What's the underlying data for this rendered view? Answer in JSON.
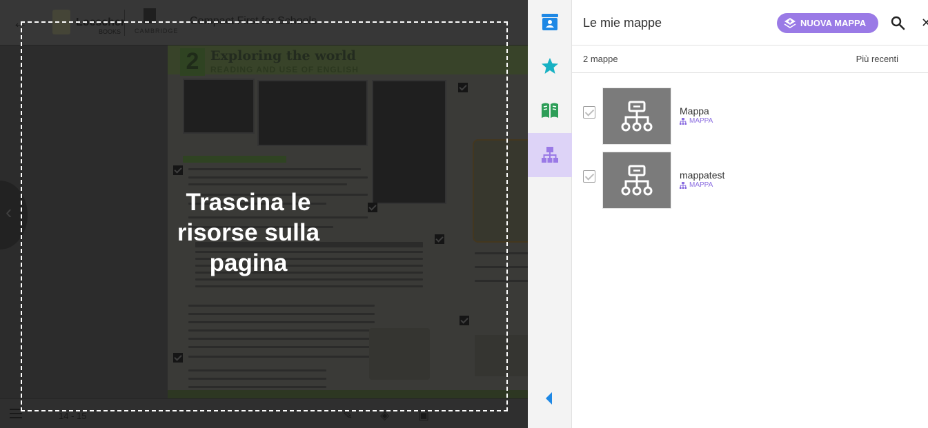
{
  "reader": {
    "brand_name": "Loescher",
    "brand_sub": "BOOKS",
    "brand_2": "CAMBRIDGE",
    "book_title": "Compact First for Schools",
    "unit_number": "2",
    "page_heading": "Exploring the world",
    "page_subheading": "READING AND USE OF ENGLISH",
    "page_range": "14 - 15",
    "drop_text": "Trascina le risorse sulla pagina"
  },
  "rail": {
    "items": [
      {
        "icon": "bag-person-icon",
        "color": "#1e88e5"
      },
      {
        "icon": "star-icon",
        "color": "#17b1c3"
      },
      {
        "icon": "book-icon",
        "color": "#2e9e58"
      },
      {
        "icon": "sitemap-icon",
        "color": "#9a7ae6"
      }
    ],
    "collapse_icon": "chevron-left-icon"
  },
  "panel": {
    "title": "Le mie mappe",
    "new_map_label": "NUOVA MAPPA",
    "count_label": "2 mappe",
    "sort_label": "Più recenti",
    "maps": [
      {
        "name": "Mappa",
        "type": "MAPPA"
      },
      {
        "name": "mappatest",
        "type": "MAPPA"
      }
    ]
  },
  "colors": {
    "accent": "#9a7ae6",
    "rail_active_bg": "#ddd3f7"
  }
}
